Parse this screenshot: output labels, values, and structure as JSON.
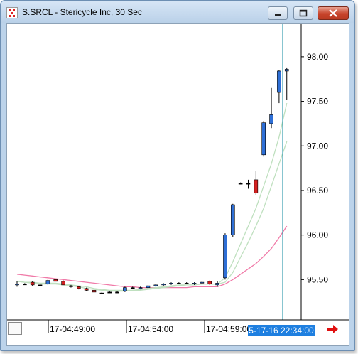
{
  "window": {
    "title": "S.SRCL - Stericycle Inc, 30 Sec"
  },
  "chart_data": {
    "type": "candlestick",
    "y_ticks": [
      "98.00",
      "97.50",
      "97.00",
      "96.50",
      "96.00",
      "95.50"
    ],
    "ylim": [
      95.08,
      98.35
    ],
    "x_tick_labels": [
      "17-04:49:00",
      "17-04:54:00",
      "17-04:59:00"
    ],
    "current_time_label": "5-17-16 22:34:00",
    "colors": {
      "up": "#2e6fd6",
      "down": "#d42020",
      "doji": "#000000",
      "ma_fast": "#bfe0bf",
      "ma_slow": "#f07aa8",
      "cursor": "#3a9fb0"
    },
    "candles": [
      {
        "o": 95.44,
        "h": 95.48,
        "l": 95.42,
        "c": 95.45
      },
      {
        "o": 95.45,
        "h": 95.46,
        "l": 95.44,
        "c": 95.45
      },
      {
        "o": 95.47,
        "h": 95.48,
        "l": 95.43,
        "c": 95.44
      },
      {
        "o": 95.44,
        "h": 95.45,
        "l": 95.43,
        "c": 95.44
      },
      {
        "o": 95.45,
        "h": 95.5,
        "l": 95.44,
        "c": 95.49
      },
      {
        "o": 95.5,
        "h": 95.51,
        "l": 95.48,
        "c": 95.48
      },
      {
        "o": 95.48,
        "h": 95.49,
        "l": 95.44,
        "c": 95.44
      },
      {
        "o": 95.43,
        "h": 95.44,
        "l": 95.41,
        "c": 95.42
      },
      {
        "o": 95.42,
        "h": 95.43,
        "l": 95.39,
        "c": 95.4
      },
      {
        "o": 95.4,
        "h": 95.41,
        "l": 95.37,
        "c": 95.38
      },
      {
        "o": 95.38,
        "h": 95.39,
        "l": 95.35,
        "c": 95.36
      },
      {
        "o": 95.35,
        "h": 95.36,
        "l": 95.34,
        "c": 95.35
      },
      {
        "o": 95.36,
        "h": 95.37,
        "l": 95.35,
        "c": 95.36
      },
      {
        "o": 95.36,
        "h": 95.37,
        "l": 95.35,
        "c": 95.36
      },
      {
        "o": 95.37,
        "h": 95.42,
        "l": 95.36,
        "c": 95.41
      },
      {
        "o": 95.41,
        "h": 95.42,
        "l": 95.4,
        "c": 95.41
      },
      {
        "o": 95.4,
        "h": 95.42,
        "l": 95.39,
        "c": 95.41
      },
      {
        "o": 95.41,
        "h": 95.44,
        "l": 95.4,
        "c": 95.43
      },
      {
        "o": 95.43,
        "h": 95.45,
        "l": 95.42,
        "c": 95.44
      },
      {
        "o": 95.44,
        "h": 95.46,
        "l": 95.43,
        "c": 95.45
      },
      {
        "o": 95.45,
        "h": 95.47,
        "l": 95.44,
        "c": 95.46
      },
      {
        "o": 95.46,
        "h": 95.47,
        "l": 95.45,
        "c": 95.46
      },
      {
        "o": 95.46,
        "h": 95.47,
        "l": 95.45,
        "c": 95.46
      },
      {
        "o": 95.45,
        "h": 95.47,
        "l": 95.44,
        "c": 95.46
      },
      {
        "o": 95.46,
        "h": 95.48,
        "l": 95.45,
        "c": 95.47
      },
      {
        "o": 95.48,
        "h": 95.49,
        "l": 95.44,
        "c": 95.45
      },
      {
        "o": 95.44,
        "h": 95.48,
        "l": 95.42,
        "c": 95.46
      },
      {
        "o": 95.52,
        "h": 96.02,
        "l": 95.5,
        "c": 96.0
      },
      {
        "o": 96.0,
        "h": 96.35,
        "l": 95.98,
        "c": 96.34
      },
      {
        "o": 96.58,
        "h": 96.59,
        "l": 96.57,
        "c": 96.58
      },
      {
        "o": 96.58,
        "h": 96.62,
        "l": 96.52,
        "c": 96.58
      },
      {
        "o": 96.62,
        "h": 96.72,
        "l": 96.45,
        "c": 96.47
      },
      {
        "o": 96.9,
        "h": 97.28,
        "l": 96.88,
        "c": 97.26
      },
      {
        "o": 97.25,
        "h": 97.65,
        "l": 97.2,
        "c": 97.35
      },
      {
        "o": 97.6,
        "h": 97.85,
        "l": 97.48,
        "c": 97.84
      },
      {
        "o": 97.84,
        "h": 97.88,
        "l": 97.52,
        "c": 97.86
      }
    ],
    "ma_fast": [
      95.48,
      95.47,
      95.46,
      95.45,
      95.45,
      95.45,
      95.44,
      95.43,
      95.42,
      95.4,
      95.39,
      95.38,
      95.37,
      95.37,
      95.37,
      95.38,
      95.39,
      95.4,
      95.41,
      95.42,
      95.43,
      95.44,
      95.44,
      95.44,
      95.45,
      95.45,
      95.45,
      95.52,
      95.7,
      95.9,
      96.1,
      96.3,
      96.55,
      96.8,
      97.1,
      97.48
    ],
    "ma_slow": [
      95.48,
      95.47,
      95.47,
      95.46,
      95.46,
      95.46,
      95.45,
      95.44,
      95.43,
      95.42,
      95.4,
      95.39,
      95.38,
      95.38,
      95.38,
      95.38,
      95.38,
      95.39,
      95.4,
      95.41,
      95.42,
      95.43,
      95.44,
      95.44,
      95.45,
      95.45,
      95.45,
      95.47,
      95.58,
      95.75,
      95.92,
      96.1,
      96.3,
      96.55,
      96.8,
      97.05
    ],
    "ma_pink": [
      95.56,
      95.55,
      95.54,
      95.53,
      95.52,
      95.51,
      95.5,
      95.49,
      95.48,
      95.47,
      95.46,
      95.45,
      95.44,
      95.43,
      95.42,
      95.42,
      95.41,
      95.41,
      95.41,
      95.41,
      95.41,
      95.41,
      95.41,
      95.42,
      95.42,
      95.42,
      95.42,
      95.45,
      95.5,
      95.56,
      95.62,
      95.68,
      95.76,
      95.85,
      95.97,
      96.1
    ]
  }
}
